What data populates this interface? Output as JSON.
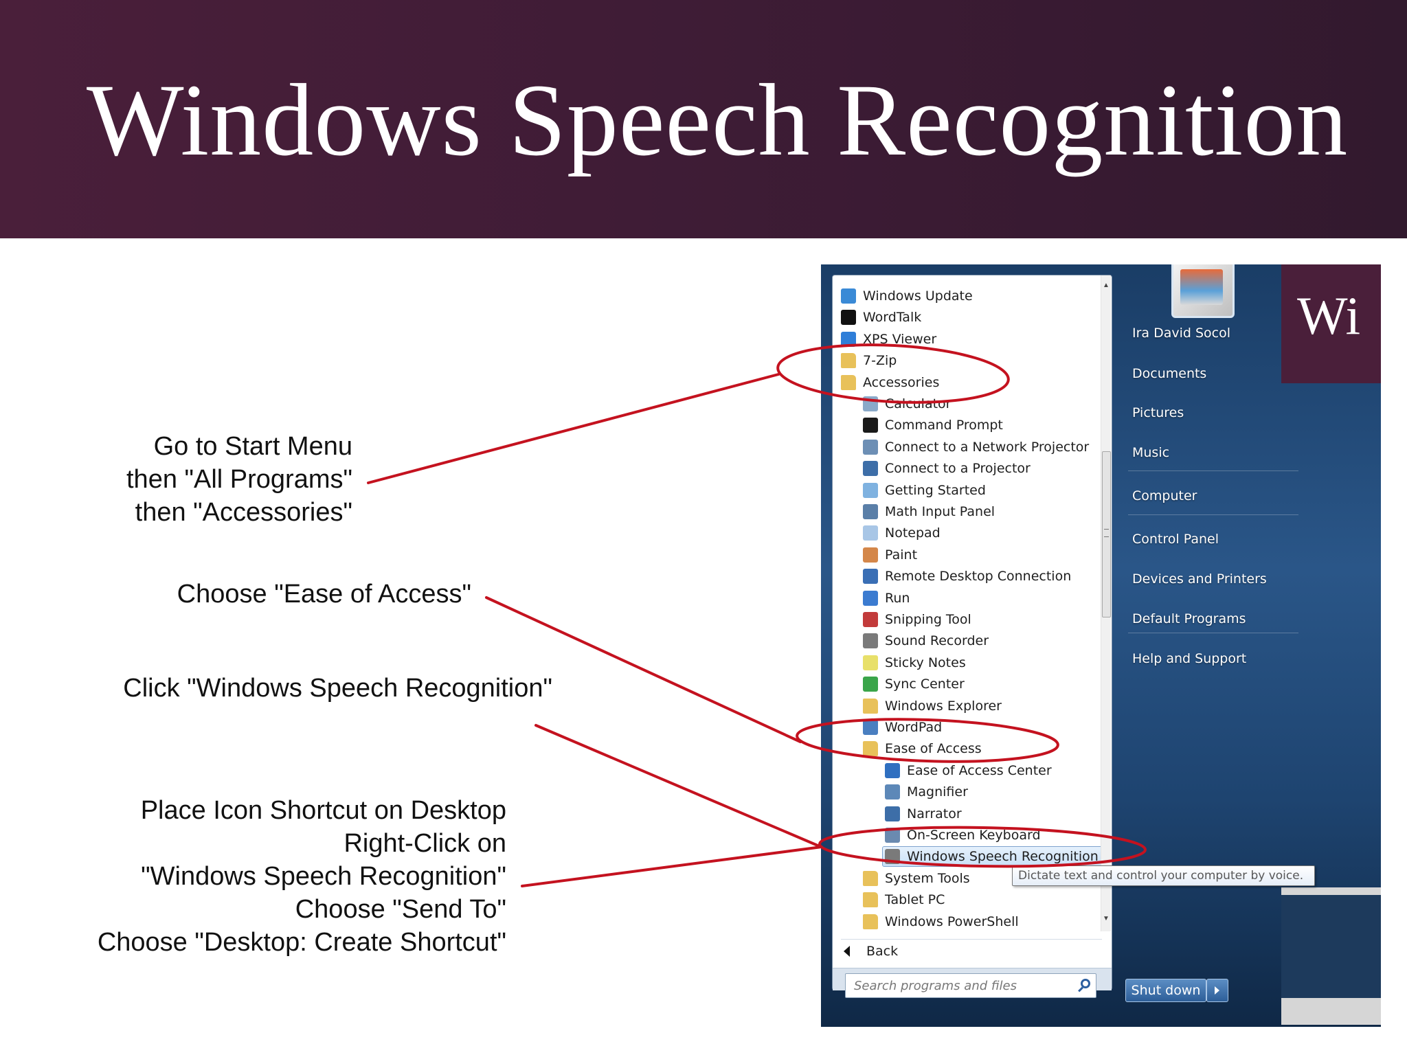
{
  "slide": {
    "title": "Windows Speech Recognition",
    "instructions": [
      [
        "Go to Start Menu",
        "then \"All Programs\"",
        "then \"Accessories\""
      ],
      [
        "Choose \"Ease of Access\""
      ],
      [
        "Click \"Windows Speech Recognition\""
      ],
      [
        "Place Icon Shortcut on Desktop",
        "Right-Click on",
        "\"Windows Speech Recognition\"",
        "Choose \"Send To\"",
        "Choose \"Desktop: Create Shortcut\""
      ]
    ],
    "peek_text": "Wi",
    "colors": {
      "banner": "#4a1f3a",
      "annotation": "#c4121f"
    }
  },
  "start_menu": {
    "programs": [
      {
        "label": "Windows Update",
        "icon": "windows-update-icon",
        "level": 0
      },
      {
        "label": "WordTalk",
        "icon": "wordtalk-icon",
        "level": 0
      },
      {
        "label": "XPS Viewer",
        "icon": "xps-viewer-icon",
        "level": 0
      },
      {
        "label": "7-Zip",
        "icon": "folder-icon",
        "level": 0
      },
      {
        "label": "Accessories",
        "icon": "folder-icon",
        "level": 0
      },
      {
        "label": "Calculator",
        "icon": "calculator-icon",
        "level": 1
      },
      {
        "label": "Command Prompt",
        "icon": "command-prompt-icon",
        "level": 1
      },
      {
        "label": "Connect to a Network Projector",
        "icon": "network-projector-icon",
        "level": 1
      },
      {
        "label": "Connect to a Projector",
        "icon": "projector-icon",
        "level": 1
      },
      {
        "label": "Getting Started",
        "icon": "getting-started-icon",
        "level": 1
      },
      {
        "label": "Math Input Panel",
        "icon": "math-input-icon",
        "level": 1
      },
      {
        "label": "Notepad",
        "icon": "notepad-icon",
        "level": 1
      },
      {
        "label": "Paint",
        "icon": "paint-icon",
        "level": 1
      },
      {
        "label": "Remote Desktop Connection",
        "icon": "remote-desktop-icon",
        "level": 1
      },
      {
        "label": "Run",
        "icon": "run-icon",
        "level": 1
      },
      {
        "label": "Snipping Tool",
        "icon": "snipping-tool-icon",
        "level": 1
      },
      {
        "label": "Sound Recorder",
        "icon": "microphone-icon",
        "level": 1
      },
      {
        "label": "Sticky Notes",
        "icon": "sticky-notes-icon",
        "level": 1
      },
      {
        "label": "Sync Center",
        "icon": "sync-center-icon",
        "level": 1
      },
      {
        "label": "Windows Explorer",
        "icon": "folder-icon",
        "level": 1
      },
      {
        "label": "WordPad",
        "icon": "wordpad-icon",
        "level": 1
      },
      {
        "label": "Ease of Access",
        "icon": "folder-icon",
        "level": 1
      },
      {
        "label": "Ease of Access Center",
        "icon": "ease-of-access-icon",
        "level": 2
      },
      {
        "label": "Magnifier",
        "icon": "magnifier-icon",
        "level": 2
      },
      {
        "label": "Narrator",
        "icon": "narrator-icon",
        "level": 2
      },
      {
        "label": "On-Screen Keyboard",
        "icon": "keyboard-icon",
        "level": 2
      },
      {
        "label": "Windows Speech Recognition",
        "icon": "microphone-icon",
        "level": 2,
        "selected": true
      },
      {
        "label": "System Tools",
        "icon": "folder-icon",
        "level": 1
      },
      {
        "label": "Tablet PC",
        "icon": "folder-icon",
        "level": 1
      },
      {
        "label": "Windows PowerShell",
        "icon": "folder-icon",
        "level": 1
      }
    ],
    "back_label": "Back",
    "search_placeholder": "Search programs and files",
    "right_items": [
      "Ira David Socol",
      "Documents",
      "Pictures",
      "Music",
      "Computer",
      "Control Panel",
      "Devices and Printers",
      "Default Programs",
      "Help and Support"
    ],
    "shutdown_label": "Shut down",
    "tooltip": "Dictate text and control your computer by voice."
  }
}
